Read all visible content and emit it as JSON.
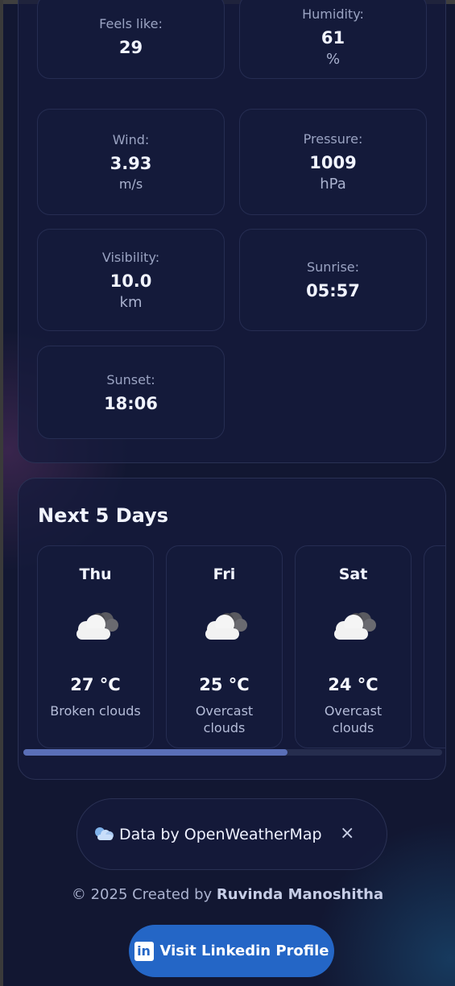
{
  "details": [
    {
      "key": "feels",
      "label": "Feels like:",
      "value": "29",
      "unit": ""
    },
    {
      "key": "humidity",
      "label": "Humidity:",
      "value": "61",
      "unit": "%"
    },
    {
      "key": "wind",
      "label": "Wind:",
      "value": "3.93",
      "unit": "m/s"
    },
    {
      "key": "pressure",
      "label": "Pressure:",
      "value": "1009",
      "unit": "hPa"
    },
    {
      "key": "visibility",
      "label": "Visibility:",
      "value": "10.0",
      "unit": "km"
    },
    {
      "key": "sunrise",
      "label": "Sunrise:",
      "value": "05:57",
      "unit": ""
    },
    {
      "key": "sunset",
      "label": "Sunset:",
      "value": "18:06",
      "unit": ""
    }
  ],
  "forecast": {
    "title": "Next 5 Days",
    "days": [
      {
        "day": "Thu",
        "icon": "cloud-icon",
        "temp": "27 °C",
        "desc": "Broken clouds"
      },
      {
        "day": "Fri",
        "icon": "cloud-icon",
        "temp": "25 °C",
        "desc": "Overcast clouds"
      },
      {
        "day": "Sat",
        "icon": "cloud-icon",
        "temp": "24 °C",
        "desc": "Overcast clouds"
      }
    ],
    "scroll_fraction": 0.63
  },
  "attribution": {
    "text": "Data by OpenWeatherMap",
    "close": "×",
    "icon": "weather-icon"
  },
  "footer": {
    "credit_prefix": "© 2025 Created by",
    "author": "Ruvinda Manoshitha",
    "button_label": "Visit Linkedin Profile",
    "button_icon": "in"
  },
  "colors": {
    "background": "#121732",
    "panel": "#161b3c",
    "accent": "#2466c6",
    "scroll_thumb": "#5a6fb8"
  }
}
